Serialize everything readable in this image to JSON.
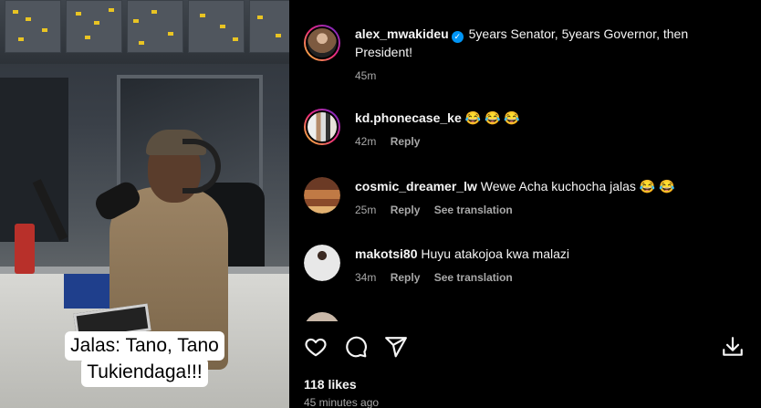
{
  "video": {
    "caption_lines": [
      "Jalas: Tano, Tano",
      "Tukiendaga!!!"
    ]
  },
  "comments": [
    {
      "username": "alex_mwakideu",
      "verified": true,
      "text": "5years Senator, 5years Governor, then President!",
      "time": "45m",
      "reply": "",
      "translate": "",
      "avatar_color": "#7d5a40"
    },
    {
      "username": "kd.phonecase_ke",
      "verified": false,
      "text": "😂 😂 😂",
      "time": "42m",
      "reply": "Reply",
      "translate": "",
      "avatar_color": "#c9c4bd"
    },
    {
      "username": "cosmic_dreamer_lw",
      "verified": false,
      "text": "Wewe Acha kuchocha jalas 😂 😂",
      "time": "25m",
      "reply": "Reply",
      "translate": "See translation",
      "avatar_color": "#a0623a"
    },
    {
      "username": "makotsi80",
      "verified": false,
      "text": "Huyu atakojoa kwa malazi",
      "time": "34m",
      "reply": "Reply",
      "translate": "See translation",
      "avatar_color": "#7a8fae"
    }
  ],
  "actions": {
    "like_icon": "heart-icon",
    "comment_icon": "comment-icon",
    "share_icon": "share-icon",
    "save_icon": "download-icon"
  },
  "post": {
    "likes": "118 likes",
    "time_ago": "45 minutes ago"
  }
}
